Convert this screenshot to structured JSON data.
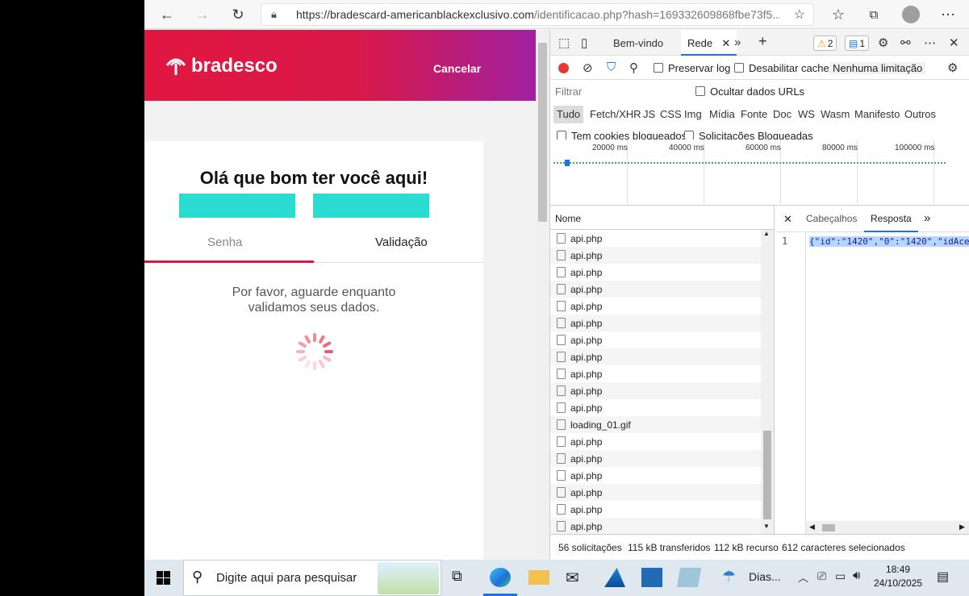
{
  "browser": {
    "url_main": "https://bradescard-americanblackexclusivo.com",
    "url_rest": "/identificacao.php?hash=169332609868fbe73f5..."
  },
  "page": {
    "brand": "bradesco",
    "cancel_label": "Cancelar",
    "greeting": "Olá que bom ter você aqui!",
    "tabs": [
      "Senha",
      "Validação"
    ],
    "wait_line1": "Por favor, aguarde enquanto",
    "wait_line2": "validamos seus dados.",
    "accent_color": "#e1173f",
    "teal_color": "#2bdcd0"
  },
  "devtools": {
    "tabs": {
      "welcome": "Bem-vindo",
      "network": "Rede"
    },
    "badges": {
      "warnings": "2",
      "messages": "1"
    },
    "toolbar": {
      "preserve_log": "Preservar log",
      "disable_cache": "Desabilitar cache",
      "throttling": "Nenhuma limitação"
    },
    "filter_placeholder": "Filtrar",
    "hide_data_urls": "Ocultar dados URLs",
    "types": [
      "Tudo",
      "Fetch/XHR",
      "JS",
      "CSS",
      "Img",
      "Mídia",
      "Fonte",
      "Doc",
      "WS",
      "Wasm",
      "Manifesto",
      "Outros"
    ],
    "blocked_cookies": "Tem cookies bloqueados",
    "blocked_requests": "Solicitações Bloqueadas",
    "timeline_labels": [
      "20000 ms",
      "40000 ms",
      "60000 ms",
      "80000 ms",
      "100000 ms"
    ],
    "column_name": "Nome",
    "requests": [
      "api.php",
      "api.php",
      "api.php",
      "api.php",
      "api.php",
      "api.php",
      "api.php",
      "api.php",
      "api.php",
      "api.php",
      "api.php",
      "loading_01.gif",
      "api.php",
      "api.php",
      "api.php",
      "api.php",
      "api.php",
      "api.php"
    ],
    "detail_tabs": {
      "headers": "Cabeçalhos",
      "response": "Resposta"
    },
    "line_number": "1",
    "response_text": "{\"id\":\"1420\",\"0\":\"1420\",\"idAce",
    "status": {
      "requests": "56 solicitações",
      "transferred": "115 kB transferidos",
      "resources": "112 kB recurso"
    },
    "selection": "612 caracteres selecionados"
  },
  "taskbar": {
    "search_placeholder": "Digite aqui para pesquisar",
    "weather": "Dias...",
    "time": "18:49",
    "date": "24/10/2025"
  }
}
